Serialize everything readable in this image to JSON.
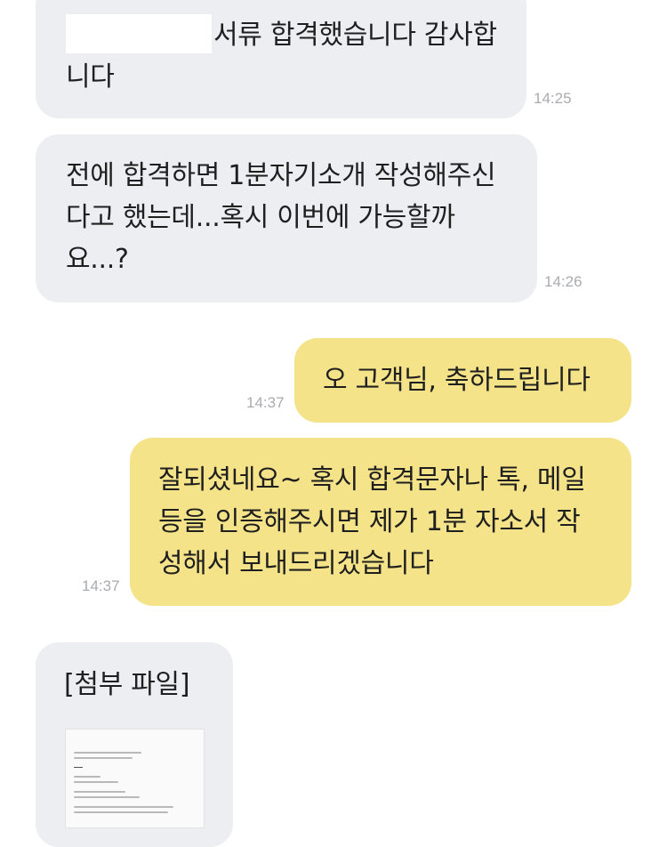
{
  "messages": [
    {
      "side": "received",
      "lines": [
        "서류 합격했습니다 감사합",
        "니다"
      ],
      "time": "14:25",
      "has_redaction": true
    },
    {
      "side": "received",
      "lines": [
        "전에 합격하면 1분자기소개 작성해주신",
        "다고 했는데...혹시 이번에 가능할까",
        "요...?"
      ],
      "time": "14:26"
    },
    {
      "side": "sent",
      "lines": [
        "오 고객님, 축하드립니다"
      ],
      "time": "14:37"
    },
    {
      "side": "sent",
      "lines": [
        "잘되셨네요~ 혹시 합격문자나 톡, 메일",
        "등을 인증해주시면 제가 1분 자소서 작",
        "성해서 보내드리겠습니다"
      ],
      "time": "14:37"
    },
    {
      "side": "received",
      "lines": [
        "[첨부 파일]"
      ],
      "attachment": true
    }
  ],
  "colors": {
    "received_bubble": "#eceef2",
    "sent_bubble": "#f5e38a",
    "timestamp": "#a9abb0",
    "text": "#1f1f1f"
  }
}
